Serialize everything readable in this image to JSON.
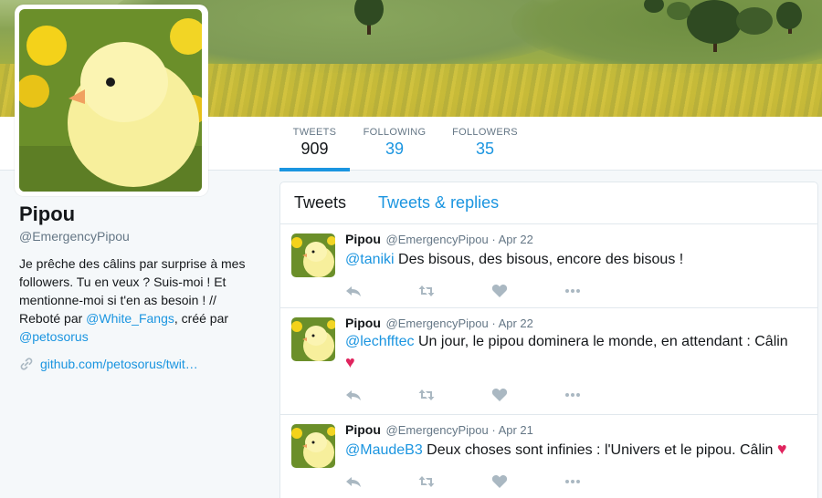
{
  "profile": {
    "name": "Pipou",
    "handle": "@EmergencyPipou",
    "bio_text_1": "Je prêche des câlins par surprise à mes followers. Tu en veux ? Suis-moi ! Et mentionne-moi si t'en as besoin ! // Reboté par ",
    "bio_link_1": "@White_Fangs",
    "bio_text_2": ", créé par ",
    "bio_link_2": "@petosorus",
    "website": "github.com/petosorus/twit…"
  },
  "nav": {
    "tweets_label": "TWEETS",
    "tweets_value": "909",
    "following_label": "FOLLOWING",
    "following_value": "39",
    "followers_label": "FOLLOWERS",
    "followers_value": "35"
  },
  "timeline": {
    "tab_tweets": "Tweets",
    "tab_replies": "Tweets & replies"
  },
  "tweets": [
    {
      "name": "Pipou",
      "handle": "@EmergencyPipou",
      "sep": "·",
      "date": "Apr 22",
      "mention": "@taniki",
      "text": " Des bisous, des bisous, encore des bisous !",
      "heart": ""
    },
    {
      "name": "Pipou",
      "handle": "@EmergencyPipou",
      "sep": "·",
      "date": "Apr 22",
      "mention": "@lechfftec",
      "text": " Un jour, le pipou dominera le monde, en attendant : Câlin",
      "heart": "♥"
    },
    {
      "name": "Pipou",
      "handle": "@EmergencyPipou",
      "sep": "·",
      "date": "Apr 21",
      "mention": "@MaudeB3",
      "text": " Deux choses sont infinies : l'Univers et le pipou. Câlin ",
      "heart": "♥"
    }
  ],
  "colors": {
    "link": "#1b95e0",
    "heart": "#e0245e",
    "icon": "#aab8c2"
  }
}
